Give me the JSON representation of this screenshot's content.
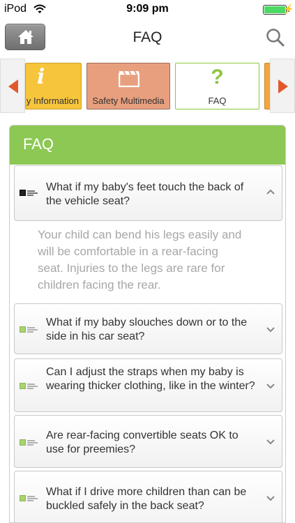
{
  "status_bar": {
    "carrier": "iPod",
    "time": "9:09 pm",
    "battery_level": 1.0,
    "battery_color": "#4cd964",
    "wifi_icon": "wifi-icon",
    "charging_icon": "bolt-icon"
  },
  "nav": {
    "title": "FAQ",
    "home_icon": "home-icon",
    "search_icon": "search-icon"
  },
  "categories": [
    {
      "label": "y Information",
      "icon": "info-icon",
      "color": "#f7c53b"
    },
    {
      "label": "Safety Multimedia",
      "icon": "clapperboard-icon",
      "color": "#e89f7e"
    },
    {
      "label": "FAQ",
      "icon": "question-icon",
      "color": "#ffffff",
      "selected": true
    }
  ],
  "faq": {
    "header": "FAQ",
    "accent": "#8cc853",
    "items": [
      {
        "question": "What if my baby's feet touch the back of the vehicle seat?",
        "expanded": true,
        "answer": "Your child can bend his legs easily and will be comfortable in a rear-facing seat. Injuries to the legs are rare for children facing the rear."
      },
      {
        "question": "What if my baby slouches down or to the side in his car seat?",
        "expanded": false
      },
      {
        "question": "Can I adjust the straps when my baby is wearing thicker clothing, like in the winter?",
        "expanded": false
      },
      {
        "question": "Are rear-facing convertible seats OK to use for preemies?",
        "expanded": false
      },
      {
        "question": "What if I drive more children than can be buckled safely in the back seat?",
        "expanded": false
      }
    ]
  }
}
